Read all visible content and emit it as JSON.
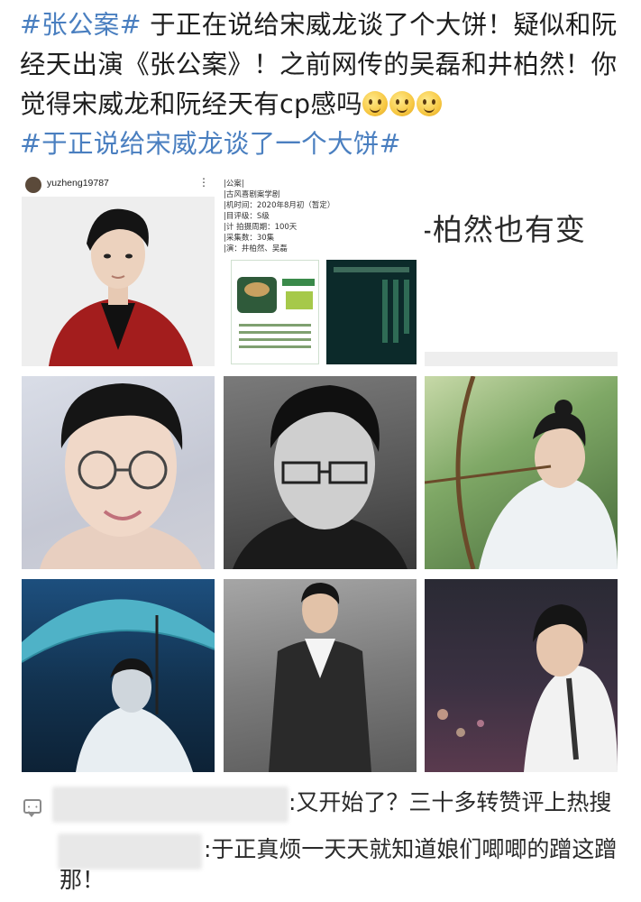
{
  "post": {
    "hashtag1": "#张公案#",
    "body": " 于正在说给宋威龙谈了个大饼！疑似和阮经天出演《张公案》！之前网传的吴磊和井柏然！你觉得宋威龙和阮经天有cp感吗",
    "hashtag2": "#于正说给宋威龙谈了一个大饼#",
    "emoji_names": [
      "thinking-face-icon",
      "thinking-face-icon",
      "thinking-face-icon"
    ]
  },
  "images": {
    "instagram_username": "yuzheng19787",
    "doc_lines": [
      "|公案|",
      "|古风喜剧案学剧",
      "|机时间：2020年8月初（暂定）",
      "|目评级：S级",
      "|计 拍摄周期：100天",
      "|采集数：30集",
      "|演：井柏然、吴磊"
    ],
    "snippet_text": "-柏然也有变"
  },
  "comments": [
    {
      "text": ":又开始了？三十多转赞评上热搜"
    },
    {
      "text_line1": ":于正真烦一天天就知道娘们唧唧的蹭这蹭",
      "text_line2": "那！"
    }
  ]
}
